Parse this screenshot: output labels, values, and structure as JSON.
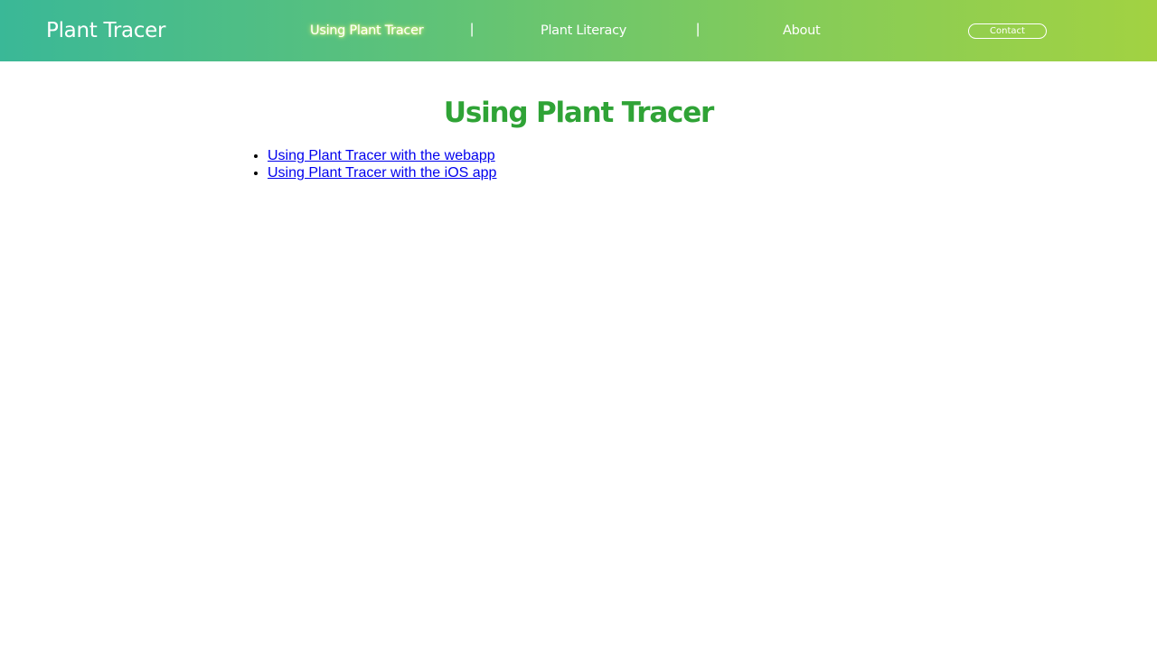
{
  "header": {
    "brand": "Plant Tracer",
    "nav": [
      {
        "label": "Using Plant Tracer"
      },
      {
        "label": "Plant Literacy"
      },
      {
        "label": "About"
      }
    ],
    "separator": "|",
    "contact_label": "Contact"
  },
  "main": {
    "title": "Using Plant Tracer",
    "links": [
      {
        "label": "Using Plant Tracer with the webapp"
      },
      {
        "label": "Using Plant Tracer with the iOS app"
      }
    ]
  },
  "colors": {
    "header_gradient_start": "#3ab897",
    "header_gradient_end": "#a2d242",
    "title_green": "#2fa336",
    "link_blue": "#0000ee"
  }
}
